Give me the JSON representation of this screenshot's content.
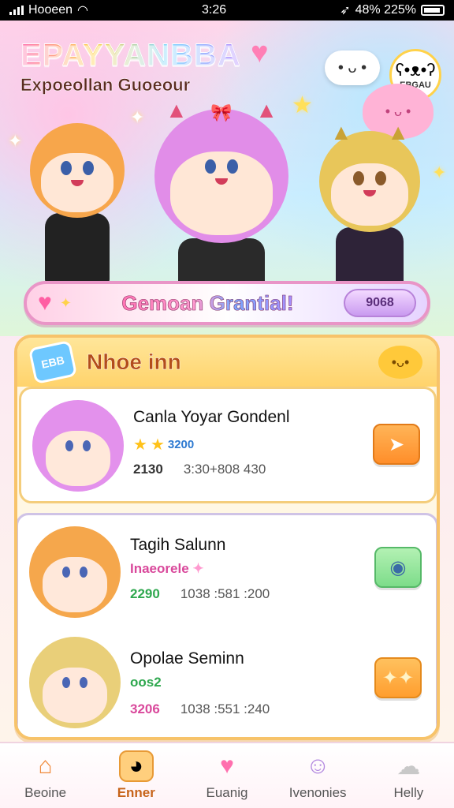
{
  "status_bar": {
    "carrier": "Hooeen",
    "time": "3:26",
    "right_text": "48% 225%"
  },
  "header": {
    "app_title": "EPAYYANBBA",
    "subtitle": "Expoeollan Guoeour",
    "profile_badge": "EBGAU"
  },
  "banner": {
    "text": "Gemoan Grantial!",
    "button_label": "9068"
  },
  "panel": {
    "badge": "EBB",
    "title": "Nhoe inn",
    "items": [
      {
        "name": "Canla Yoyar Gondenl",
        "rating_text": "3200",
        "meta_lead": "2130",
        "meta_tail": "3:30+808 430"
      },
      {
        "name": "Tagih Salunn",
        "tag": "Inaeorele",
        "meta_lead": "2290",
        "meta_tail": "1038 :581 :200"
      },
      {
        "name": "Opolae Seminn",
        "tag": "oos2",
        "meta_lead": "3206",
        "meta_tail": "1038 :551 :240"
      }
    ]
  },
  "bottom_nav": [
    {
      "label": "Beoine",
      "icon": "home-icon"
    },
    {
      "label": "Enner",
      "icon": "chat-icon"
    },
    {
      "label": "Euanig",
      "icon": "heart-icon"
    },
    {
      "label": "Ivenonies",
      "icon": "ghost-icon"
    },
    {
      "label": "Helly",
      "icon": "cloud-icon"
    }
  ],
  "colors": {
    "accent_pink": "#ff6fae",
    "panel_border": "#f7c36a",
    "active_nav": "#c7641a"
  }
}
